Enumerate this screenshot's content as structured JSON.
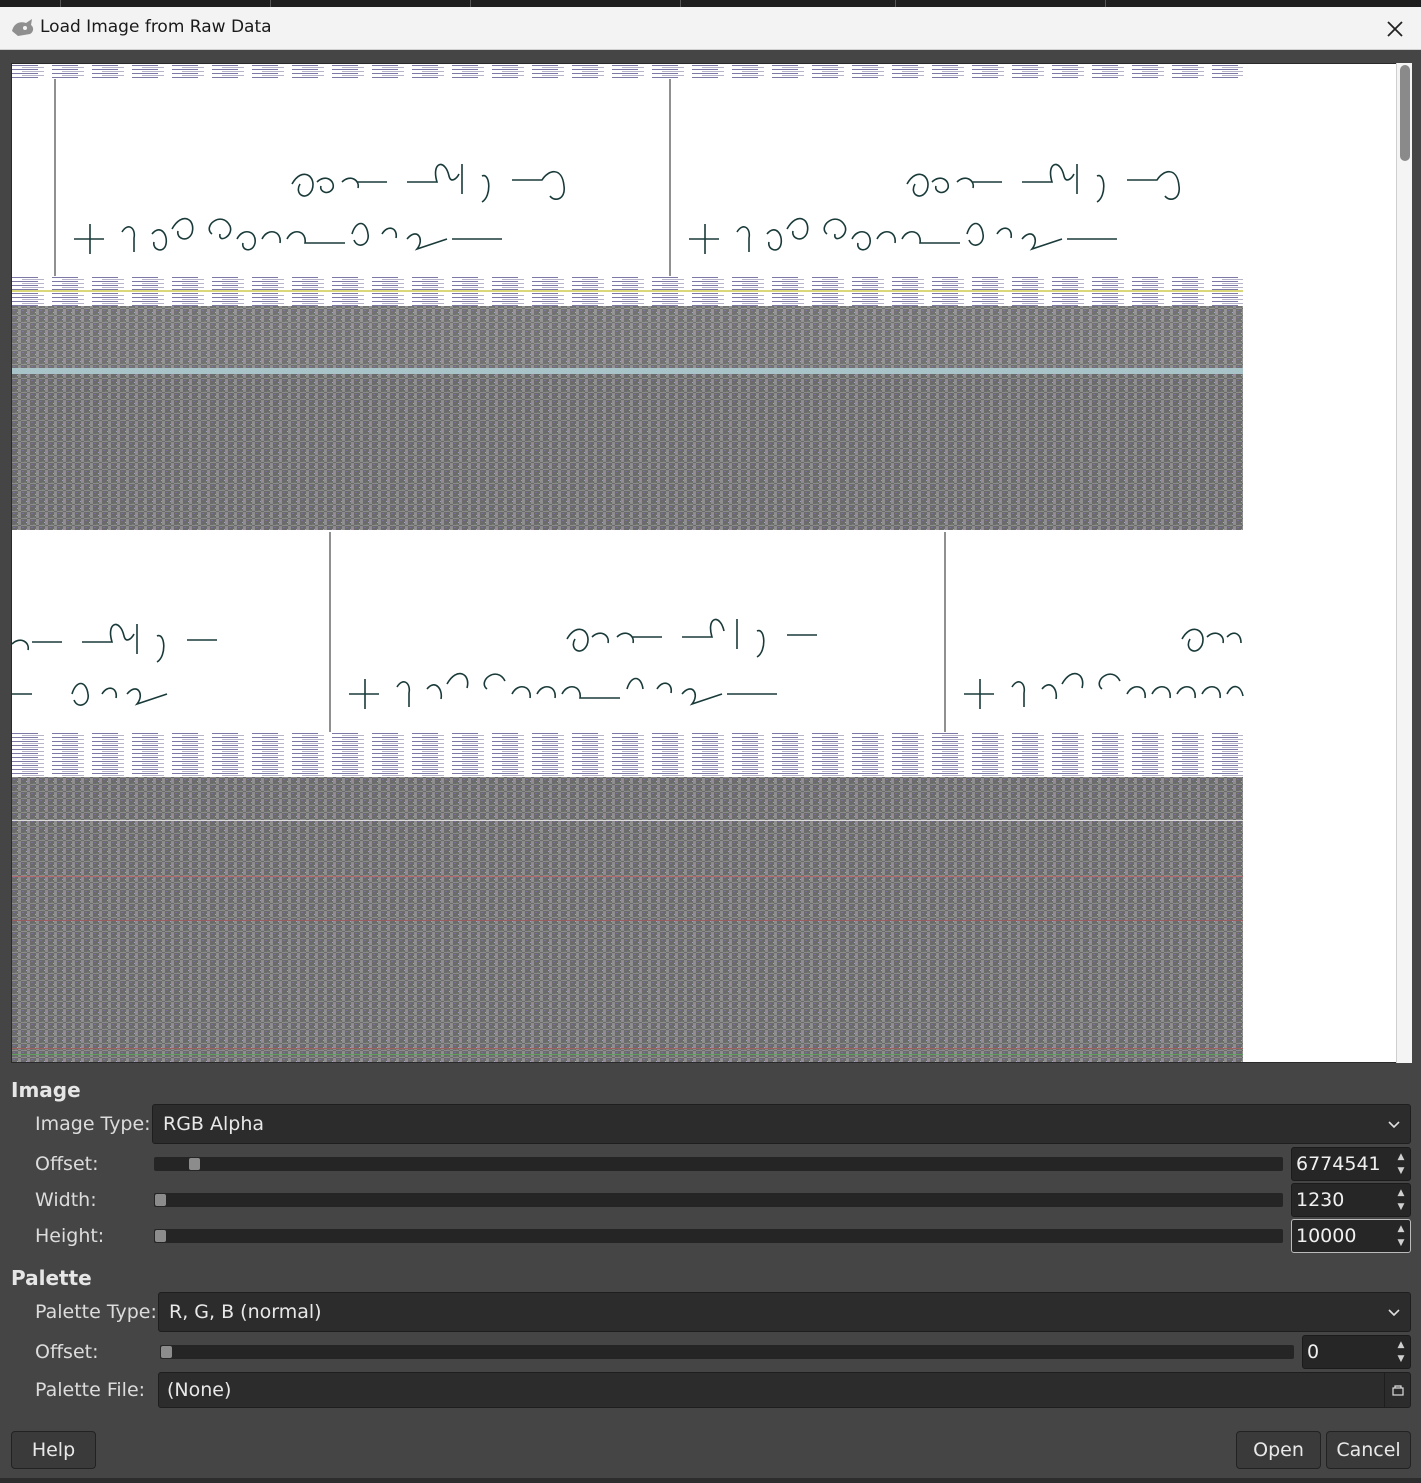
{
  "window": {
    "title": "Load Image from Raw Data"
  },
  "image_section": {
    "heading": "Image",
    "image_type_label": "Image Type:",
    "image_type_value": "RGB Alpha",
    "offset_label": "Offset:",
    "offset_value": "6774541",
    "offset_slider_fraction": 0.03,
    "width_label": "Width:",
    "width_value": "1230",
    "width_slider_fraction": 0.0,
    "height_label": "Height:",
    "height_value": "10000",
    "height_slider_fraction": 0.0
  },
  "palette_section": {
    "heading": "Palette",
    "palette_type_label": "Palette Type:",
    "palette_type_value": "R, G, B (normal)",
    "offset_label": "Offset:",
    "offset_value": "0",
    "offset_slider_fraction": 0.0,
    "palette_file_label": "Palette File:",
    "palette_file_value": "(None)"
  },
  "buttons": {
    "help": "Help",
    "open": "Open",
    "cancel": "Cancel"
  },
  "icons": {
    "app": "gimp-wilber-icon",
    "close": "close-icon",
    "dropdown": "chevron-down-icon",
    "file": "file-chooser-icon"
  },
  "colors": {
    "dialog_bg": "#454545",
    "titlebar_bg": "#f3f3f3",
    "field_bg": "#2c2c2c",
    "preview_bg": "#ffffff"
  }
}
